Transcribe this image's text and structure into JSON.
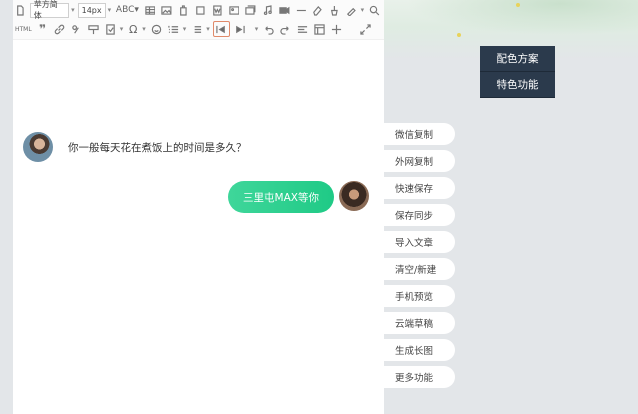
{
  "toolbar": {
    "font_family": "苹方简体",
    "font_size": "14px",
    "abc_label": "ABC",
    "html_label": "HTML"
  },
  "chat": {
    "question": "你一般每天花在煮饭上的时间是多久？",
    "answer": "三里屯MAX等你"
  },
  "scheme": {
    "color_scheme": "配色方案",
    "special_features": "特色功能"
  },
  "side_menu": [
    {
      "label": "微信复制"
    },
    {
      "label": "外网复制"
    },
    {
      "label": "快速保存"
    },
    {
      "label": "保存同步"
    },
    {
      "label": "导入文章"
    },
    {
      "label": "清空/新建"
    },
    {
      "label": "手机预览"
    },
    {
      "label": "云端草稿"
    },
    {
      "label": "生成长图"
    },
    {
      "label": "更多功能"
    }
  ],
  "colors": {
    "bubble_green": "#1fca86",
    "scheme_dark": "#2b3a4c"
  }
}
